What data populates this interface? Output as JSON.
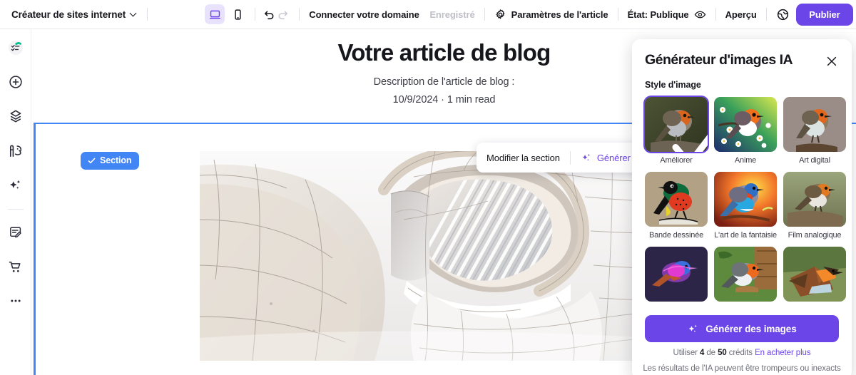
{
  "topbar": {
    "brand": "Créateur de sites internet",
    "brand_caret_icon": "chevron-down-icon",
    "desktop_icon": "desktop-monitor-icon",
    "mobile_icon": "mobile-phone-icon",
    "undo_icon": "undo-arrow-icon",
    "redo_icon": "redo-arrow-icon",
    "connect_domain": "Connecter votre domaine",
    "saved_status": "Enregistré",
    "settings_icon": "gear-icon",
    "settings_label": "Paramètres de l'article",
    "state_label": "État: Publique",
    "eye_icon": "eye-icon",
    "preview_label": "Aperçu",
    "globe_icon": "globe-icon",
    "publish_label": "Publier",
    "accent_color": "#6c45e8",
    "active_device_bg": "#e9e2fd"
  },
  "sidebar": {
    "items": [
      {
        "name": "sidebar-item-pages",
        "icon": "pages-checklist-icon"
      },
      {
        "name": "sidebar-item-add",
        "icon": "plus-circle-icon"
      },
      {
        "name": "sidebar-item-layers",
        "icon": "layers-icon"
      },
      {
        "name": "sidebar-item-theme",
        "icon": "paint-palette-icon"
      },
      {
        "name": "sidebar-item-ai",
        "icon": "sparkles-icon"
      },
      {
        "name": "sidebar-item-blog",
        "icon": "blog-edit-icon"
      },
      {
        "name": "sidebar-item-store",
        "icon": "shopping-cart-icon"
      },
      {
        "name": "sidebar-item-more",
        "icon": "ellipsis-icon"
      }
    ]
  },
  "canvas": {
    "blog_title": "Votre article de blog",
    "blog_description": "Description de l'article de blog :",
    "blog_meta": "10/9/2024 · 1 min read",
    "section_badge": "Section",
    "section_badge_icon": "check-icon",
    "section_color": "#4285f4",
    "hero_alt": "architecture-curved-white-panels-image"
  },
  "float_toolbar": {
    "edit_section": "Modifier la section",
    "generate_icon": "sparkles-icon",
    "generate_label": "Générer u"
  },
  "ai_panel": {
    "title": "Générateur d'images IA",
    "close_icon": "close-icon",
    "section_label": "Style d'image",
    "styles": [
      {
        "label": "Améliorer",
        "selected": true
      },
      {
        "label": "Anime",
        "selected": false
      },
      {
        "label": "Art digital",
        "selected": false
      },
      {
        "label": "Bande dessinée",
        "selected": false
      },
      {
        "label": "L'art de la fantaisie",
        "selected": false
      },
      {
        "label": "Film analogique",
        "selected": false
      },
      {
        "label": "",
        "selected": false
      },
      {
        "label": "",
        "selected": false
      },
      {
        "label": "",
        "selected": false
      }
    ],
    "generate_button": "Générer des images",
    "generate_button_icon": "sparkles-icon",
    "credits_prefix": "Utiliser",
    "credits_used": "4",
    "credits_mid": "de",
    "credits_total": "50",
    "credits_suffix": "crédits",
    "buy_more": "En acheter plus",
    "disclaimer": "Les résultats de l'IA peuvent être trompeurs ou inexacts",
    "accent_color": "#6c45e8"
  }
}
